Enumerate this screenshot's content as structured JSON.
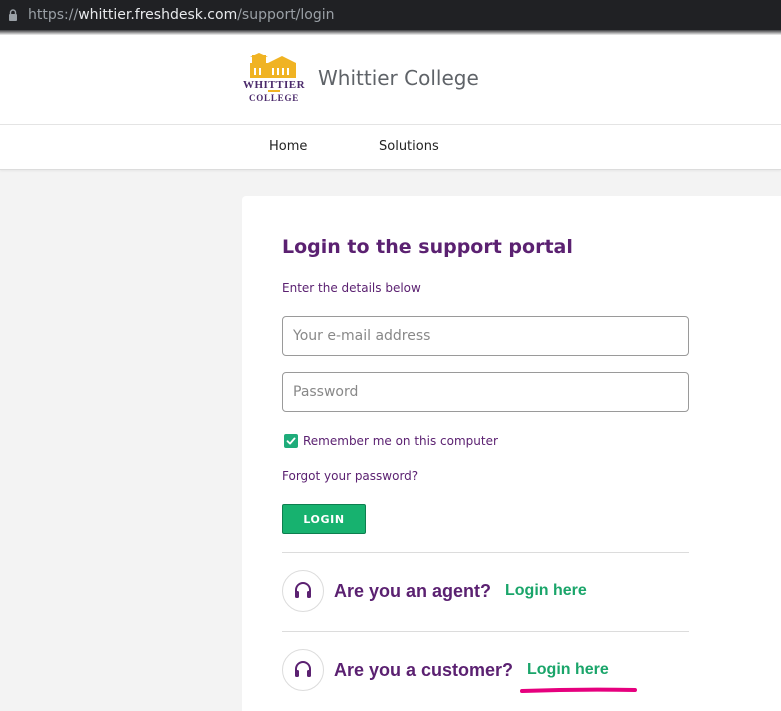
{
  "browser": {
    "url_scheme": "https://",
    "url_host": "whittier.freshdesk.com",
    "url_path": "/support/login"
  },
  "header": {
    "site_title": "Whittier College",
    "logo_text": "Whittier College"
  },
  "nav": {
    "home": "Home",
    "solutions": "Solutions"
  },
  "login": {
    "title": "Login to the support portal",
    "subtitle": "Enter the details below",
    "email_placeholder": "Your e-mail address",
    "password_placeholder": "Password",
    "remember_label": "Remember me on this computer",
    "remember_checked": true,
    "forgot_label": "Forgot your password?",
    "login_button": "LOGIN"
  },
  "roles": {
    "agent_question": "Are you an agent?",
    "agent_link": "Login here",
    "customer_question": "Are you a customer?",
    "customer_link": "Login here"
  },
  "colors": {
    "brand_purple": "#5b2171",
    "accent_green": "#17b26f",
    "highlight_pink": "#e6007e"
  },
  "icons": {
    "lock": "lock-icon",
    "checkbox": "checkmark-icon",
    "role": "headset-icon"
  }
}
